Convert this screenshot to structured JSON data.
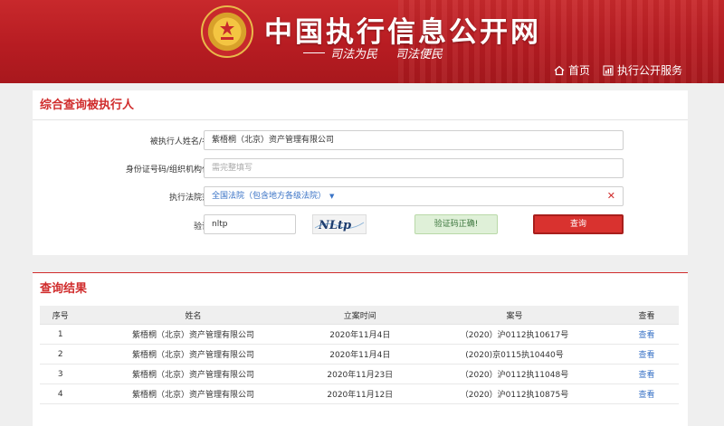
{
  "header": {
    "title": "中国执行信息公开网",
    "slogan": [
      "司法为民",
      "司法便民"
    ],
    "nav": [
      {
        "label": "首页",
        "icon": "home-icon"
      },
      {
        "label": "执行公开服务",
        "icon": "chart-icon"
      }
    ],
    "colors": {
      "brand_red": "#c8292c",
      "link_blue": "#3a73c6"
    }
  },
  "query": {
    "title": "综合查询被执行人",
    "name_label": "被执行人姓名/名称:",
    "name_value": "紫梧桐（北京）资产管理有限公司",
    "id_label": "身份证号码/组织机构代码:",
    "id_placeholder": "需完整填写",
    "court_label": "执行法院范围:",
    "court_value": "全国法院（包含地方各级法院）",
    "captcha_label": "验证码:",
    "captcha_value": "nltp",
    "captcha_image_text": "NLtp",
    "verify_status": "验证码正确!",
    "search_button": "查询"
  },
  "results": {
    "title": "查询结果",
    "columns": [
      "序号",
      "姓名",
      "立案时间",
      "案号",
      "查看"
    ],
    "rows": [
      [
        "1",
        "紫梧桐（北京）资产管理有限公司",
        "2020年11月4日",
        "（2020）沪0112执10617号",
        "查看"
      ],
      [
        "2",
        "紫梧桐（北京）资产管理有限公司",
        "2020年11月4日",
        "(2020)京0115执10440号",
        "查看"
      ],
      [
        "3",
        "紫梧桐（北京）资产管理有限公司",
        "2020年11月23日",
        "（2020）沪0112执11048号",
        "查看"
      ],
      [
        "4",
        "紫梧桐（北京）资产管理有限公司",
        "2020年11月12日",
        "（2020）沪0112执10875号",
        "查看"
      ]
    ]
  }
}
